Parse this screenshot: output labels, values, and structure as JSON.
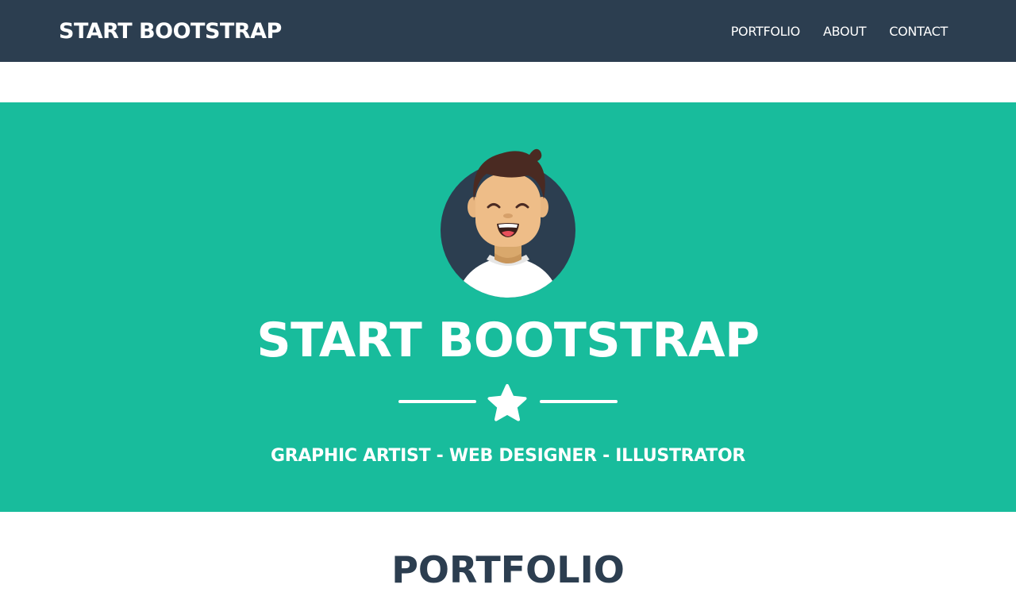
{
  "navbar": {
    "brand": "START BOOTSTRAP",
    "links": [
      {
        "label": "PORTFOLIO"
      },
      {
        "label": "ABOUT"
      },
      {
        "label": "CONTACT"
      }
    ]
  },
  "masthead": {
    "title": "START BOOTSTRAP",
    "subtitle": "GRAPHIC ARTIST - WEB DESIGNER - ILLUSTRATOR",
    "divider_icon": "star-icon",
    "avatar_icon": "avatar-icon"
  },
  "portfolio_section": {
    "title": "PORTFOLIO"
  },
  "colors": {
    "primary": "#2c3e50",
    "secondary": "#18bc9c",
    "text_light": "#ffffff"
  }
}
